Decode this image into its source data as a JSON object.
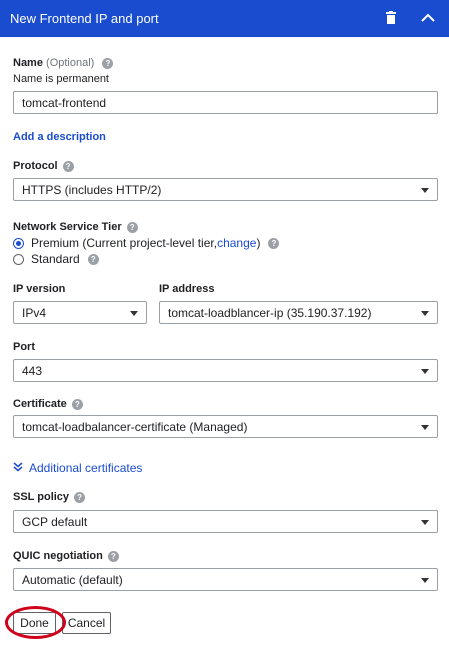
{
  "header": {
    "title": "New Frontend IP and port",
    "trash_icon": "trash-icon",
    "collapse_icon": "chevron-up-icon",
    "color": "#1a4ccf"
  },
  "name": {
    "label": "Name",
    "optional": "(Optional)",
    "note": "Name is permanent",
    "value": "tomcat-frontend"
  },
  "add_description": "Add a description",
  "protocol": {
    "label": "Protocol",
    "value": "HTTPS (includes HTTP/2)"
  },
  "network_tier": {
    "label": "Network Service Tier",
    "options": [
      {
        "label": "Premium (Current project-level tier, ",
        "link": "change",
        "suffix": ")",
        "selected": true
      },
      {
        "label": "Standard",
        "selected": false
      }
    ]
  },
  "ip_version": {
    "label": "IP version",
    "value": "IPv4"
  },
  "ip_address": {
    "label": "IP address",
    "value": "tomcat-loadblancer-ip (35.190.37.192)"
  },
  "port": {
    "label": "Port",
    "value": "443"
  },
  "certificate": {
    "label": "Certificate",
    "value": "tomcat-loadbalancer-certificate (Managed)"
  },
  "additional_certificates": "Additional certificates",
  "ssl_policy": {
    "label": "SSL policy",
    "value": "GCP default"
  },
  "quic": {
    "label": "QUIC negotiation",
    "value": "Automatic (default)"
  },
  "buttons": {
    "done": "Done",
    "cancel": "Cancel"
  },
  "help_glyph": "?",
  "highlight_color": "#d0021b"
}
